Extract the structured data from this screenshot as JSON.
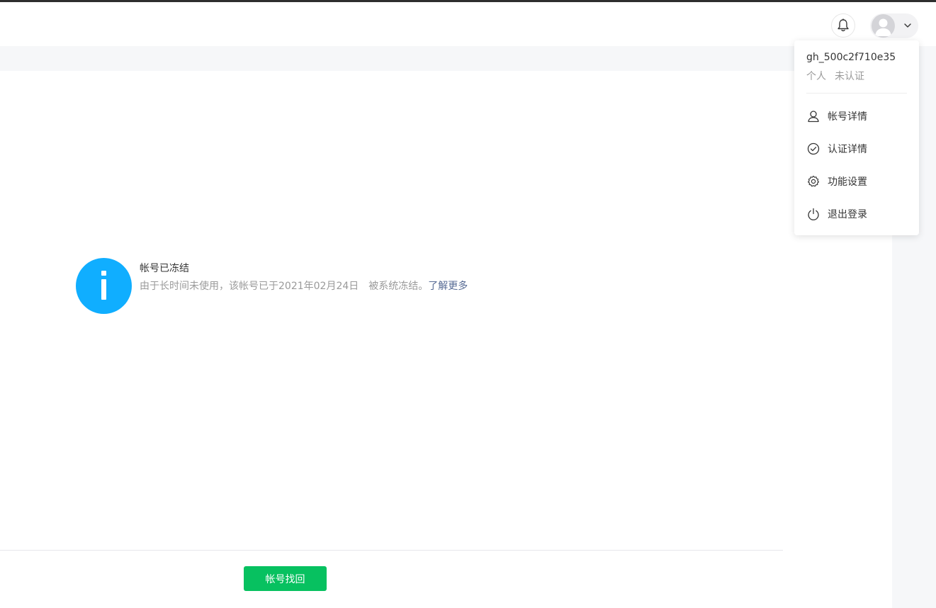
{
  "header": {
    "notification_icon": "bell-icon",
    "account_icon": "avatar",
    "dropdown_icon": "chevron-down-icon"
  },
  "notice": {
    "icon": "info-icon",
    "title": "帐号已冻结",
    "desc_prefix": "由于长时间未使用，该帐号已于",
    "date": "2021年02月24日",
    "desc_suffix": "被系统冻结。",
    "learn_more": "了解更多"
  },
  "actions": {
    "recover_label": "帐号找回"
  },
  "account_menu": {
    "username": "gh_500c2f710e35",
    "type": "个人",
    "verify_status": "未认证",
    "items": [
      {
        "label": "帐号详情",
        "icon": "user-icon"
      },
      {
        "label": "认证详情",
        "icon": "check-circle-icon"
      },
      {
        "label": "功能设置",
        "icon": "gear-icon"
      },
      {
        "label": "退出登录",
        "icon": "power-icon"
      }
    ]
  },
  "colors": {
    "info_blue": "#10aeff",
    "primary_green": "#07c160",
    "link": "#576b95"
  }
}
